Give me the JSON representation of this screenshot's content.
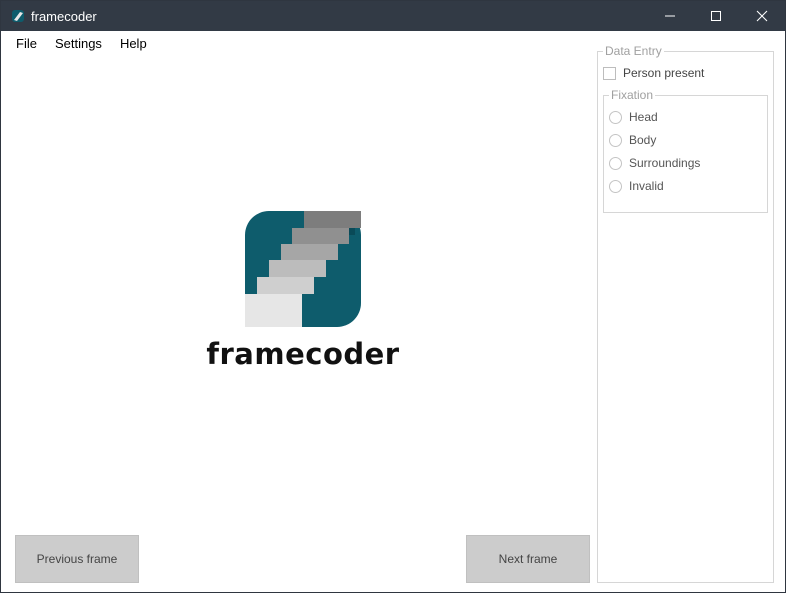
{
  "window": {
    "title": "framecoder"
  },
  "menu": [
    "File",
    "Settings",
    "Help"
  ],
  "logo": {
    "text": "framecoder"
  },
  "buttons": {
    "previous": "Previous frame",
    "next": "Next frame"
  },
  "data_entry": {
    "title": "Data Entry",
    "person_present": {
      "label": "Person present",
      "checked": false
    },
    "fixation": {
      "title": "Fixation",
      "options": [
        "Head",
        "Body",
        "Surroundings",
        "Invalid"
      ],
      "selected": null
    }
  },
  "colors": {
    "titlebar": "#323a45",
    "logo_teal": "#0e5c6c",
    "button": "#cccccc"
  }
}
